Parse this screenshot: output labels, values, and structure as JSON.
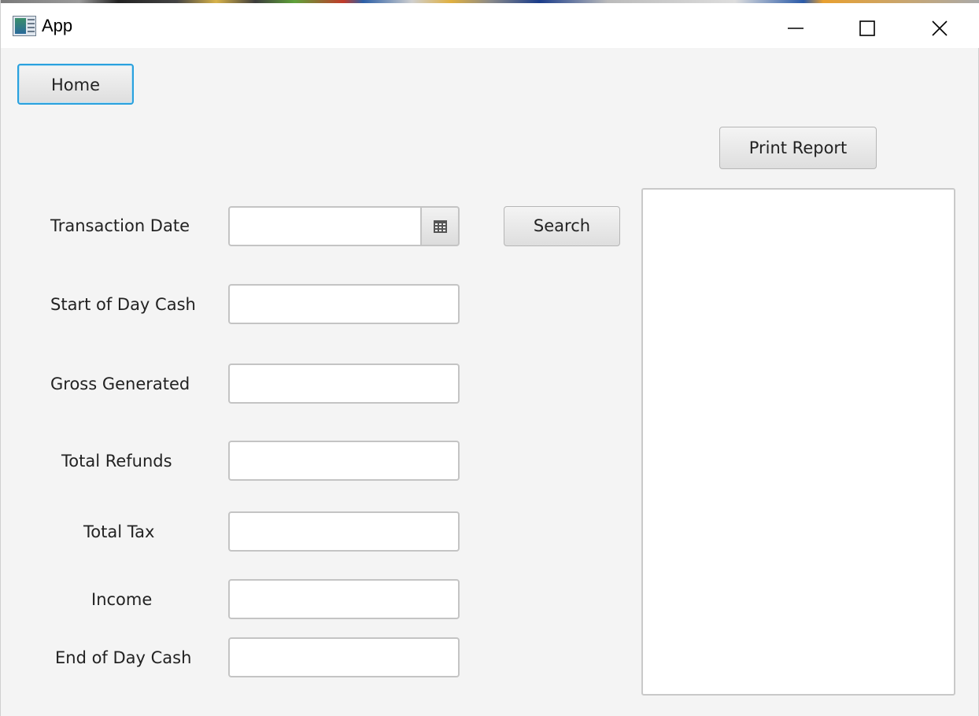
{
  "window": {
    "title": "App",
    "controls": [
      "minimize-icon",
      "maximize-icon",
      "close-icon"
    ]
  },
  "toolbar": {
    "home_label": "Home",
    "print_label": "Print Report",
    "search_label": "Search"
  },
  "form": {
    "transaction_date": {
      "label": "Transaction Date",
      "value": ""
    },
    "start_of_day_cash": {
      "label": "Start of Day Cash",
      "value": ""
    },
    "gross_generated": {
      "label": "Gross Generated",
      "value": ""
    },
    "total_refunds": {
      "label": "Total Refunds",
      "value": ""
    },
    "total_tax": {
      "label": "Total Tax",
      "value": ""
    },
    "income": {
      "label": "Income",
      "value": ""
    },
    "end_of_day_cash": {
      "label": "End of Day Cash",
      "value": ""
    }
  },
  "report": {
    "text": ""
  },
  "colors": {
    "focus_border": "#2aa1de",
    "background": "#f4f4f4",
    "titlebar": "#ffffff"
  }
}
